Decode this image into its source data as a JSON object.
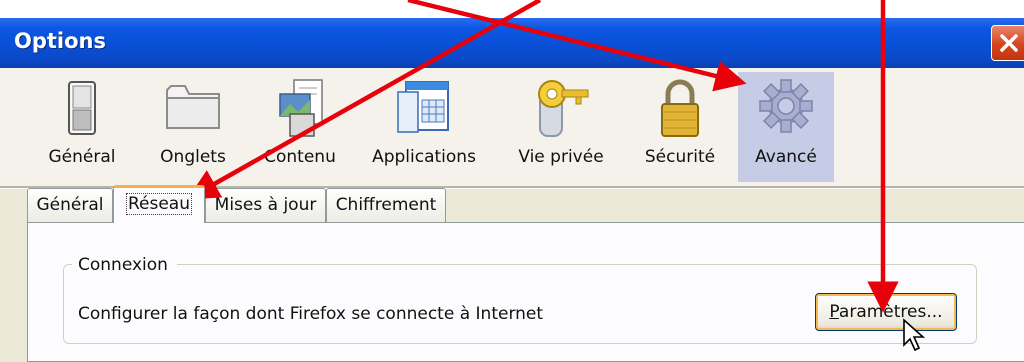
{
  "window": {
    "title": "Options"
  },
  "toolbar": {
    "panes": [
      {
        "label": "Général",
        "icon": "switch-icon"
      },
      {
        "label": "Onglets",
        "icon": "tab-folder-icon"
      },
      {
        "label": "Contenu",
        "icon": "content-images-icon"
      },
      {
        "label": "Applications",
        "icon": "applications-window-icon"
      },
      {
        "label": "Vie privée",
        "icon": "privacy-key-icon"
      },
      {
        "label": "Sécurité",
        "icon": "padlock-icon"
      },
      {
        "label": "Avancé",
        "icon": "gear-icon",
        "selected": true
      }
    ]
  },
  "tabs": [
    {
      "label": "Général"
    },
    {
      "label": "Réseau",
      "active": true
    },
    {
      "label": "Mises à jour"
    },
    {
      "label": "Chiffrement"
    }
  ],
  "connexion": {
    "legend": "Connexion",
    "description": "Configurer la façon dont Firefox se connecte à Internet",
    "button_accel": "P",
    "button_rest": "aramètres..."
  },
  "colors": {
    "titlebar": "#0a4fd6",
    "selected_pane": "#c6cce5",
    "annotation_arrow": "#e8000b"
  }
}
